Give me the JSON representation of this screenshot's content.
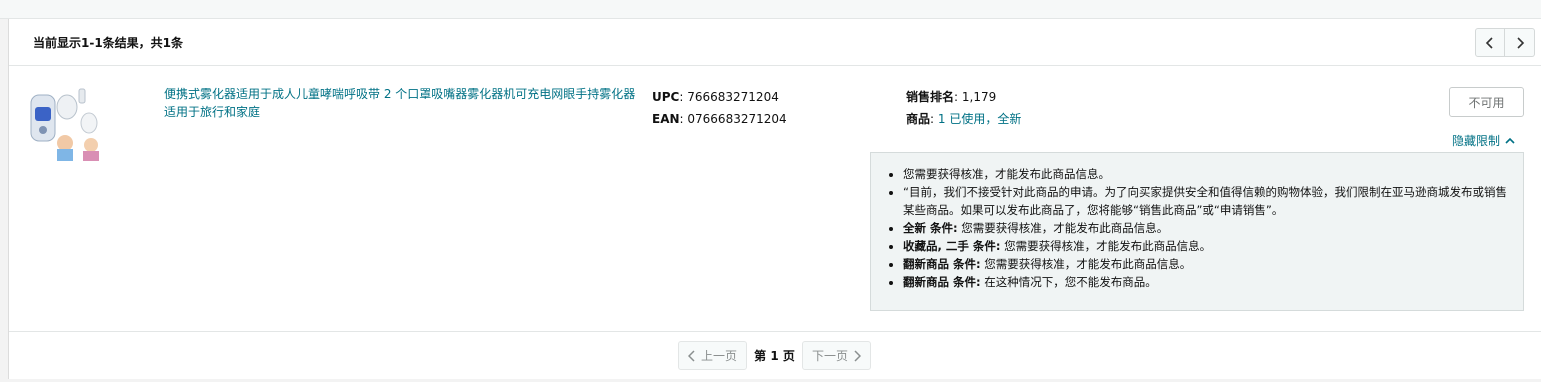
{
  "header": {
    "result_count": "当前显示1-1条结果，共1条"
  },
  "listing": {
    "title": "便携式雾化器适用于成人儿童哮喘呼吸带 2 个口罩吸嘴器雾化器机可充电网眼手持雾化器适用于旅行和家庭",
    "upc_label": "UPC",
    "upc_value": ": 766683271204",
    "ean_label": "EAN",
    "ean_value": ": 0766683271204",
    "sales_rank_label": "销售排名",
    "sales_rank_value": ": 1,179",
    "offers_label": "商品",
    "offers_value": ": ",
    "offers_link": "1 已使用，全新",
    "unavailable_button": "不可用",
    "hide_restrictions": "隐藏限制"
  },
  "restrictions": {
    "items": [
      {
        "bold": "",
        "text": "您需要获得核准，才能发布此商品信息。"
      },
      {
        "bold": "",
        "text": "“目前，我们不接受针对此商品的申请。为了向买家提供安全和值得信赖的购物体验，我们限制在亚马逊商城发布或销售某些商品。如果可以发布此商品了，您将能够“销售此商品”或“申请销售”。"
      },
      {
        "bold": "全新 条件:",
        "text": " 您需要获得核准，才能发布此商品信息。"
      },
      {
        "bold": "收藏品, 二手 条件:",
        "text": " 您需要获得核准，才能发布此商品信息。"
      },
      {
        "bold": "翻新商品 条件:",
        "text": " 您需要获得核准，才能发布此商品信息。"
      },
      {
        "bold": "翻新商品 条件:",
        "text": " 在这种情况下，您不能发布商品。"
      }
    ]
  },
  "pagination": {
    "prev_label": "上一页",
    "current_label": "第 1 页",
    "next_label": "下一页"
  },
  "colors": {
    "link": "#007185",
    "restriction_bg": "#f0f4f4"
  },
  "icons": {
    "prev_page": "chevron-left-icon",
    "next_page": "chevron-right-icon",
    "collapse": "chevron-up-icon"
  }
}
